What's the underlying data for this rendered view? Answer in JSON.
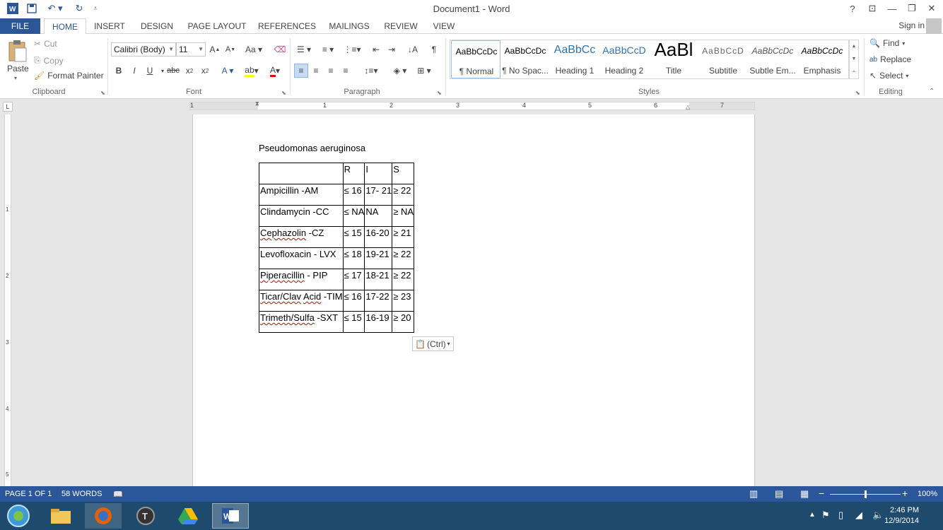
{
  "app": {
    "title": "Document1 - Word"
  },
  "window_controls": {
    "help": "?",
    "ribbon_display": "⊡",
    "minimize": "—",
    "restore": "❐",
    "close": "✕"
  },
  "tabs": [
    {
      "label": "FILE"
    },
    {
      "label": "HOME"
    },
    {
      "label": "INSERT"
    },
    {
      "label": "DESIGN"
    },
    {
      "label": "PAGE LAYOUT"
    },
    {
      "label": "REFERENCES"
    },
    {
      "label": "MAILINGS"
    },
    {
      "label": "REVIEW"
    },
    {
      "label": "VIEW"
    }
  ],
  "sign_in": "Sign in",
  "clipboard": {
    "paste": "Paste",
    "cut": "Cut",
    "copy": "Copy",
    "format_painter": "Format Painter",
    "label": "Clipboard"
  },
  "font": {
    "family": "Calibri (Body)",
    "size": "11",
    "label": "Font"
  },
  "paragraph": {
    "label": "Paragraph"
  },
  "styles": {
    "label": "Styles",
    "items": [
      {
        "sample": "AaBbCcDc",
        "name": "¶ Normal"
      },
      {
        "sample": "AaBbCcDc",
        "name": "¶ No Spac..."
      },
      {
        "sample": "AaBbCc",
        "name": "Heading 1"
      },
      {
        "sample": "AaBbCcD",
        "name": "Heading 2"
      },
      {
        "sample": "AaBl",
        "name": "Title"
      },
      {
        "sample": "AaBbCcD",
        "name": "Subtitle"
      },
      {
        "sample": "AaBbCcDc",
        "name": "Subtle Em..."
      },
      {
        "sample": "AaBbCcDc",
        "name": "Emphasis"
      }
    ]
  },
  "editing": {
    "find": "Find",
    "replace": "Replace",
    "select": "Select",
    "label": "Editing"
  },
  "ruler": {
    "numbers": [
      "1",
      "1",
      "2",
      "3",
      "4",
      "5",
      "6",
      "7"
    ],
    "vnumbers": [
      "1",
      "2",
      "3",
      "4",
      "5"
    ]
  },
  "document": {
    "heading": "Pseudomonas aeruginosa",
    "table": {
      "header": [
        "",
        "R",
        "I",
        "S"
      ],
      "rows": [
        [
          "Ampicillin -AM",
          "≤ 16",
          "17- 21",
          "≥ 22"
        ],
        [
          "Clindamycin -CC",
          "≤ NA",
          "NA",
          "≥ NA"
        ],
        [
          "Cephazolin -CZ",
          "≤ 15",
          "16-20",
          "≥ 21"
        ],
        [
          "Levofloxacin - LVX",
          "≤ 18",
          "19-21",
          "≥ 22"
        ],
        [
          "Piperacillin - PIP",
          "≤ 17",
          "18-21",
          "≥ 22"
        ],
        [
          "Ticar/Clav Acid -TIM",
          "≤ 16",
          "17-22",
          "≥ 23"
        ],
        [
          "Trimeth/Sulfa -SXT",
          "≤ 15",
          "16-19",
          "≥ 20"
        ]
      ]
    },
    "paste_options": "(Ctrl)"
  },
  "status": {
    "page": "PAGE 1 OF 1",
    "words": "58 WORDS",
    "zoom": "100%",
    "zoom_fraction": 0.5
  },
  "taskbar": {
    "time": "2:46 PM",
    "date": "12/9/2014"
  },
  "colors": {
    "accent": "#2b579a",
    "taskbar": "#1e4a6e"
  }
}
